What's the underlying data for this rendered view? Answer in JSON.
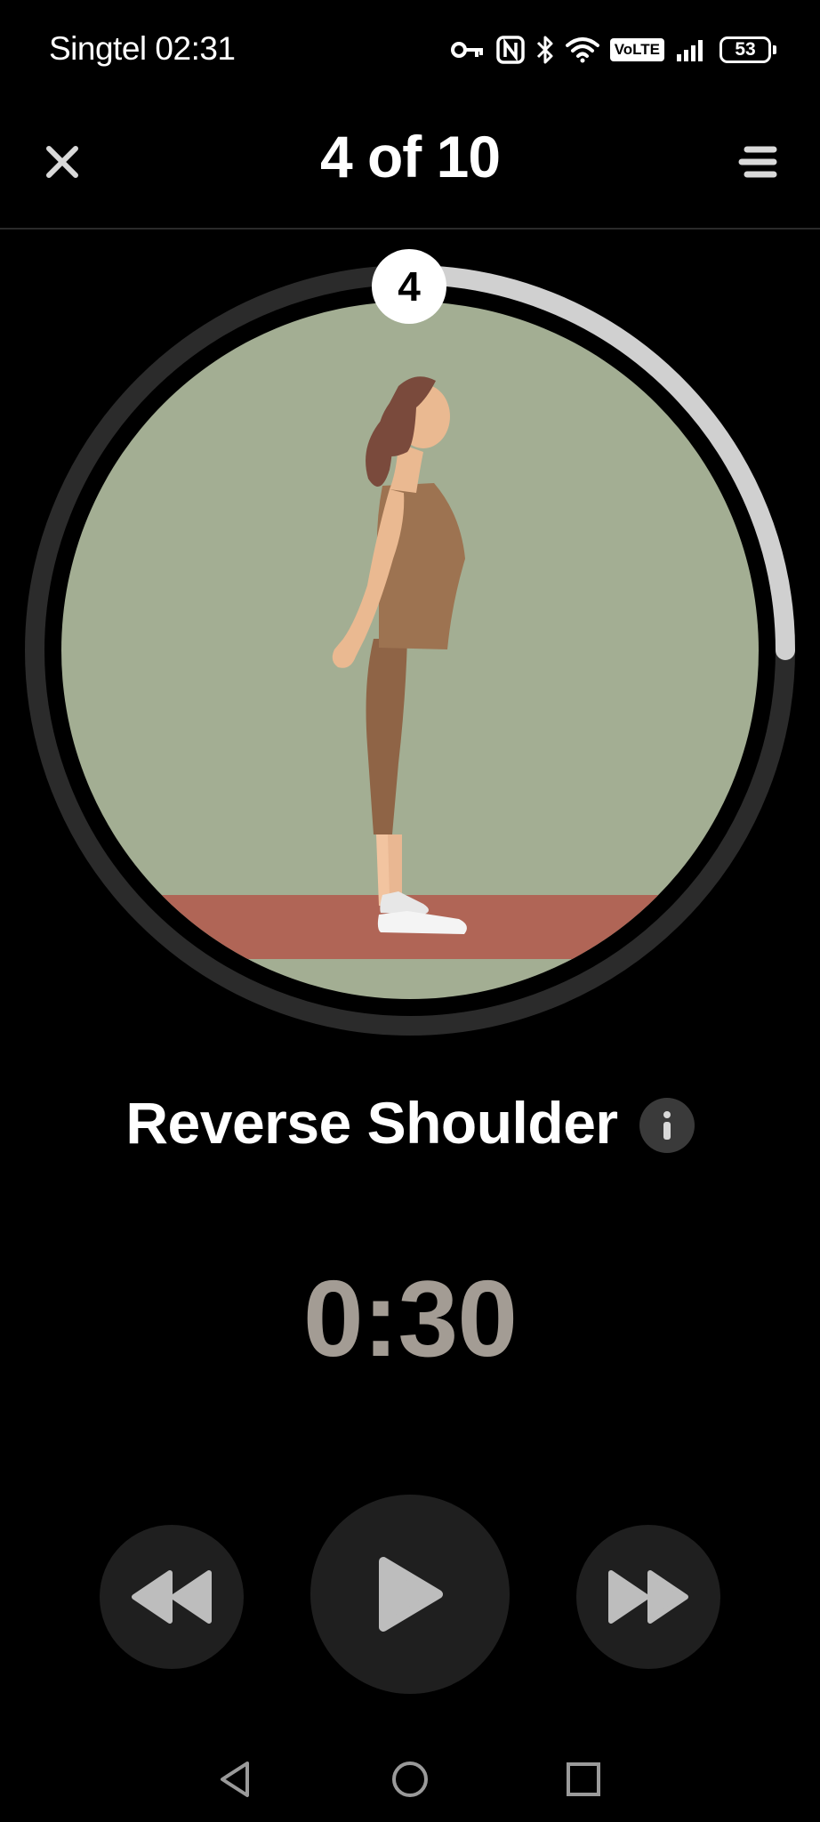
{
  "status_bar": {
    "carrier_time": "Singtel 02:31",
    "volte": "VoLTE",
    "battery": "53",
    "icons": [
      "key-icon",
      "nfc-icon",
      "bluetooth-icon",
      "wifi-icon",
      "volte-icon",
      "signal-icon",
      "battery-icon"
    ]
  },
  "header": {
    "title": "4 of 10",
    "close_icon": "close-icon",
    "menu_icon": "menu-icon"
  },
  "exercise": {
    "step_number": "4",
    "name": "Reverse Shoulder",
    "info_icon": "info-icon",
    "progress_fraction": 0.25,
    "illustration": "woman-stretching-illustration",
    "colors": {
      "background": "#a3ae93",
      "mat": "#b06556",
      "ring_track": "#2b2b2b",
      "ring_progress": "#d0d0d0"
    }
  },
  "timer": {
    "value": "0:30",
    "color": "#a39c94"
  },
  "controls": {
    "rewind_icon": "rewind-icon",
    "play_icon": "play-icon",
    "fast_forward_icon": "fast-forward-icon"
  },
  "nav_bar": {
    "back_icon": "back-triangle-icon",
    "home_icon": "home-circle-icon",
    "recents_icon": "recents-square-icon"
  }
}
